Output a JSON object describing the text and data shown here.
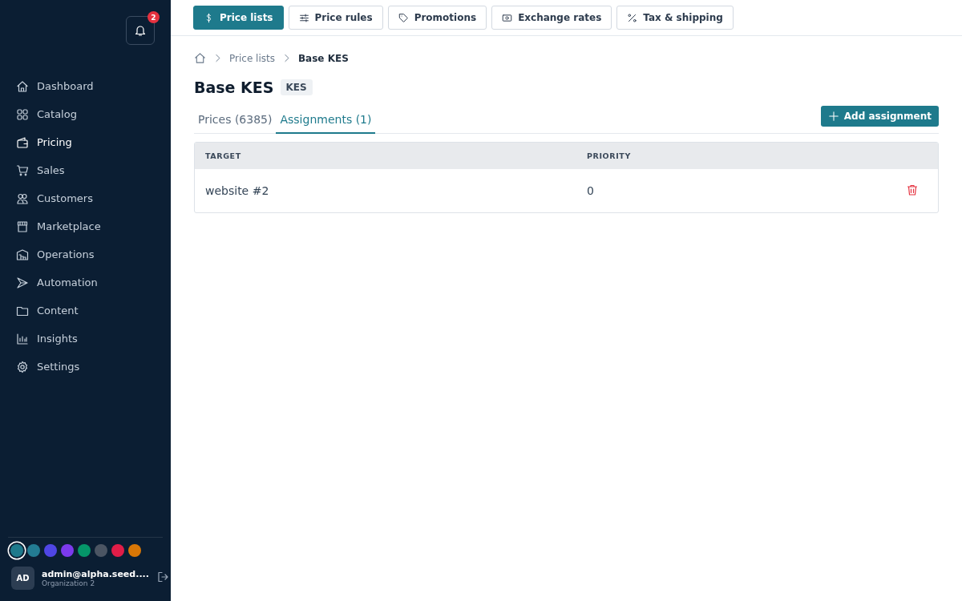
{
  "sidebar": {
    "notifications": {
      "count": "2"
    },
    "nav": [
      {
        "label": "Dashboard",
        "selected": false
      },
      {
        "label": "Catalog",
        "selected": false
      },
      {
        "label": "Pricing",
        "selected": true
      },
      {
        "label": "Sales",
        "selected": false
      },
      {
        "label": "Customers",
        "selected": false
      },
      {
        "label": "Marketplace",
        "selected": false
      },
      {
        "label": "Operations",
        "selected": false
      },
      {
        "label": "Automation",
        "selected": false
      },
      {
        "label": "Content",
        "selected": false
      },
      {
        "label": "Insights",
        "selected": false
      },
      {
        "label": "Settings",
        "selected": false
      }
    ],
    "themes": [
      {
        "color": "#1e7a8c",
        "selected": true
      },
      {
        "color": "#237c93",
        "selected": false
      },
      {
        "color": "#4f46e5",
        "selected": false
      },
      {
        "color": "#7c3aed",
        "selected": false
      },
      {
        "color": "#059669",
        "selected": false
      },
      {
        "color": "#4b5563",
        "selected": false
      },
      {
        "color": "#e11d48",
        "selected": false
      },
      {
        "color": "#d97706",
        "selected": false
      }
    ],
    "user": {
      "initials": "AD",
      "email": "admin@alpha.seed....",
      "org": "Organization 2"
    }
  },
  "top_tabs": [
    {
      "label": "Price lists",
      "selected": true
    },
    {
      "label": "Price rules",
      "selected": false
    },
    {
      "label": "Promotions",
      "selected": false
    },
    {
      "label": "Exchange rates",
      "selected": false
    },
    {
      "label": "Tax & shipping",
      "selected": false
    }
  ],
  "breadcrumb": [
    "Price lists",
    "Base KES"
  ],
  "title": "Base KES",
  "badge": "KES",
  "tabs": [
    {
      "label": "Prices (6385)",
      "selected": false
    },
    {
      "label": "Assignments (1)",
      "selected": true
    }
  ],
  "add_button": "Add assignment",
  "table": {
    "columns": [
      "TARGET",
      "PRIORITY"
    ],
    "rows": [
      {
        "target": "website #2",
        "priority": "0"
      }
    ]
  }
}
